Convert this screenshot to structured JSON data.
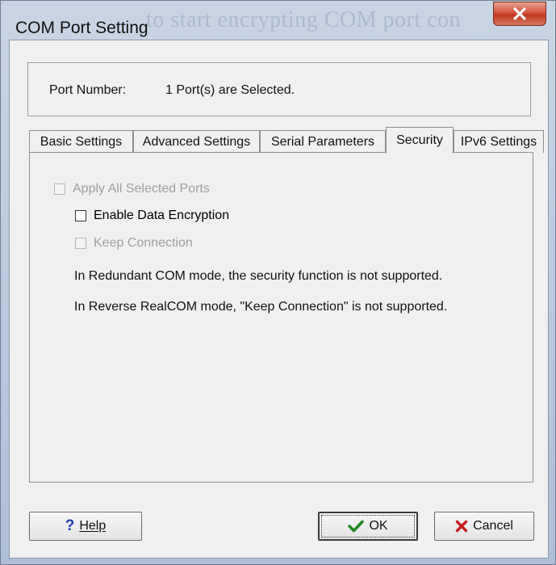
{
  "window": {
    "title": "COM Port Setting",
    "background_text": "to start encrypting COM port con"
  },
  "port": {
    "label": "Port Number:",
    "value": "1 Port(s) are Selected."
  },
  "tabs": [
    {
      "label": "Basic Settings",
      "active": false
    },
    {
      "label": "Advanced Settings",
      "active": false
    },
    {
      "label": "Serial Parameters",
      "active": false
    },
    {
      "label": "Security",
      "active": true
    },
    {
      "label": "IPv6 Settings",
      "active": false
    }
  ],
  "security": {
    "apply_all": {
      "label": "Apply All Selected Ports",
      "checked": false,
      "enabled": false
    },
    "enable_encryption": {
      "label": "Enable Data Encryption",
      "checked": false,
      "enabled": true
    },
    "keep_connection": {
      "label": "Keep Connection",
      "checked": false,
      "enabled": false
    },
    "notes": [
      "In Redundant COM mode,  the security function is not supported.",
      "In Reverse RealCOM mode, \"Keep Connection\" is not supported."
    ]
  },
  "buttons": {
    "help": "Help",
    "ok": "OK",
    "cancel": "Cancel"
  },
  "colors": {
    "close_button": "#c8452a",
    "ok_check": "#1f8a1f",
    "cancel_x": "#c81e1e",
    "help_icon": "#1a3fb0"
  },
  "icons": {
    "close": "close-icon",
    "help": "question-mark-icon",
    "ok": "checkmark-icon",
    "cancel": "x-mark-icon"
  }
}
